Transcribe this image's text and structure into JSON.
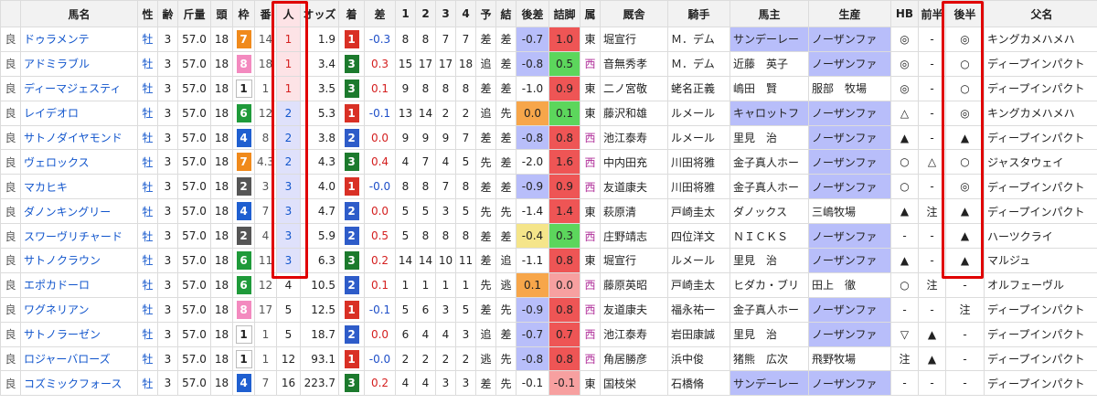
{
  "headers": [
    "",
    "馬名",
    "性",
    "齢",
    "斤量",
    "頭",
    "枠",
    "番",
    "人",
    "オッズ",
    "着",
    "差",
    "1",
    "2",
    "3",
    "4",
    "予",
    "結",
    "後差",
    "詰脚",
    "属",
    "厩舎",
    "騎手",
    "馬主",
    "生産",
    "HB",
    "前半",
    "後半",
    "父名"
  ],
  "colors": {
    "waku": {
      "1": "#ffffff",
      "2": "#555555",
      "3": "#e02222",
      "4": "#1f5fd0",
      "5": "#f2c200",
      "6": "#1f9a3a",
      "7": "#f08a1c",
      "8": "#f38abf"
    },
    "pos1": "#d93025",
    "pos2": "#2e5cc9",
    "pos3": "#1c7a2d",
    "pos_other": "#5a5a5a",
    "highlight_frame": "#e00000",
    "cell_green": "#5cd65c",
    "cell_orange": "#f7a64a",
    "cell_yellow": "#f5e58a",
    "cell_red": "#ee5555",
    "cell_lightred": "#f7a0a0",
    "lavender": "#b8befa"
  },
  "rows": [
    {
      "baba": "良",
      "name": "ドゥラメンテ",
      "sex": "牡",
      "age": "3",
      "kinryo": "57.0",
      "to": "18",
      "waku": "7",
      "ban": "14",
      "nin": "1",
      "odds": "1.9",
      "chaku": "1",
      "sa": "-0.3",
      "p1": "8",
      "p2": "8",
      "p3": "7",
      "p4": "7",
      "yo": "差",
      "ketsu": "差",
      "gosa": "-0.7",
      "gosa_bg": "lav",
      "tsume": "1.0",
      "tsume_bg": "red",
      "zoku": "東",
      "kyusha": "堀宣行",
      "kishu": "Ｍ．デム",
      "banushi": "サンデーレー",
      "banushi_lav": true,
      "seisan": "ノーザンファ",
      "seisan_lav": true,
      "hb": "◎",
      "zen": "-",
      "kou": "◎",
      "chichi": "キングカメハメハ"
    },
    {
      "baba": "良",
      "name": "アドミラブル",
      "sex": "牡",
      "age": "3",
      "kinryo": "57.0",
      "to": "18",
      "waku": "8",
      "ban": "18",
      "nin": "1",
      "odds": "3.4",
      "chaku": "3",
      "sa": "0.3",
      "p1": "15",
      "p2": "17",
      "p3": "17",
      "p4": "18",
      "yo": "追",
      "ketsu": "差",
      "gosa": "-0.8",
      "gosa_bg": "lav",
      "tsume": "0.5",
      "tsume_bg": "green",
      "zoku": "西",
      "kyusha": "音無秀孝",
      "kishu": "Ｍ．デム",
      "banushi": "近藤　英子",
      "banushi_lav": false,
      "seisan": "ノーザンファ",
      "seisan_lav": true,
      "hb": "◎",
      "zen": "-",
      "kou": "○",
      "chichi": "ディープインパクト"
    },
    {
      "baba": "良",
      "name": "ディーマジェスティ",
      "sex": "牡",
      "age": "3",
      "kinryo": "57.0",
      "to": "18",
      "waku": "1",
      "ban": "1",
      "nin": "1",
      "odds": "3.5",
      "chaku": "3",
      "sa": "0.1",
      "p1": "9",
      "p2": "8",
      "p3": "8",
      "p4": "8",
      "yo": "差",
      "ketsu": "差",
      "gosa": "-1.0",
      "gosa_bg": "none",
      "tsume": "0.9",
      "tsume_bg": "red",
      "zoku": "東",
      "kyusha": "二ノ宮敬",
      "kishu": "蛯名正義",
      "banushi": "嶋田　賢",
      "banushi_lav": false,
      "seisan": "服部　牧場",
      "seisan_lav": false,
      "hb": "◎",
      "zen": "-",
      "kou": "○",
      "chichi": "ディープインパクト"
    },
    {
      "baba": "良",
      "name": "レイデオロ",
      "sex": "牡",
      "age": "3",
      "kinryo": "57.0",
      "to": "18",
      "waku": "6",
      "ban": "12",
      "nin": "2",
      "odds": "5.3",
      "chaku": "1",
      "sa": "-0.1",
      "p1": "13",
      "p2": "14",
      "p3": "2",
      "p4": "2",
      "yo": "追",
      "ketsu": "先",
      "gosa": "0.0",
      "gosa_bg": "orange",
      "tsume": "0.1",
      "tsume_bg": "green",
      "zoku": "東",
      "kyusha": "藤沢和雄",
      "kishu": "ルメール",
      "banushi": "キャロットフ",
      "banushi_lav": true,
      "seisan": "ノーザンファ",
      "seisan_lav": true,
      "hb": "△",
      "zen": "-",
      "kou": "◎",
      "chichi": "キングカメハメハ"
    },
    {
      "baba": "良",
      "name": "サトノダイヤモンド",
      "sex": "牡",
      "age": "3",
      "kinryo": "57.0",
      "to": "18",
      "waku": "4",
      "ban": "8",
      "nin": "2",
      "odds": "3.8",
      "chaku": "2",
      "sa": "0.0",
      "p1": "9",
      "p2": "9",
      "p3": "9",
      "p4": "7",
      "yo": "差",
      "ketsu": "差",
      "gosa": "-0.8",
      "gosa_bg": "lav",
      "tsume": "0.8",
      "tsume_bg": "red",
      "zoku": "西",
      "kyusha": "池江泰寿",
      "kishu": "ルメール",
      "banushi": "里見　治",
      "banushi_lav": false,
      "seisan": "ノーザンファ",
      "seisan_lav": true,
      "hb": "▲",
      "zen": "-",
      "kou": "▲",
      "chichi": "ディープインパクト"
    },
    {
      "baba": "良",
      "name": "ヴェロックス",
      "sex": "牡",
      "age": "3",
      "kinryo": "57.0",
      "to": "18",
      "waku": "7",
      "ban": "4.3",
      "nin": "2",
      "odds": "4.3",
      "chaku": "3",
      "sa": "0.4",
      "p1": "4",
      "p2": "7",
      "p3": "4",
      "p4": "5",
      "yo": "先",
      "ketsu": "差",
      "gosa": "-2.0",
      "gosa_bg": "none",
      "tsume": "1.6",
      "tsume_bg": "red",
      "zoku": "西",
      "kyusha": "中内田充",
      "kishu": "川田将雅",
      "banushi": "金子真人ホー",
      "banushi_lav": false,
      "seisan": "ノーザンファ",
      "seisan_lav": true,
      "hb": "○",
      "zen": "△",
      "kou": "○",
      "chichi": "ジャスタウェイ"
    },
    {
      "baba": "良",
      "name": "マカヒキ",
      "sex": "牡",
      "age": "3",
      "kinryo": "57.0",
      "to": "18",
      "waku": "2",
      "ban": "3",
      "nin": "3",
      "odds": "4.0",
      "chaku": "1",
      "sa": "-0.0",
      "p1": "8",
      "p2": "8",
      "p3": "7",
      "p4": "8",
      "yo": "差",
      "ketsu": "差",
      "gosa": "-0.9",
      "gosa_bg": "lav",
      "tsume": "0.9",
      "tsume_bg": "red",
      "zoku": "西",
      "kyusha": "友道康夫",
      "kishu": "川田将雅",
      "banushi": "金子真人ホー",
      "banushi_lav": false,
      "seisan": "ノーザンファ",
      "seisan_lav": true,
      "hb": "○",
      "zen": "-",
      "kou": "◎",
      "chichi": "ディープインパクト"
    },
    {
      "baba": "良",
      "name": "ダノンキングリー",
      "sex": "牡",
      "age": "3",
      "kinryo": "57.0",
      "to": "18",
      "waku": "4",
      "ban": "7",
      "nin": "3",
      "odds": "4.7",
      "chaku": "2",
      "sa": "0.0",
      "p1": "5",
      "p2": "5",
      "p3": "3",
      "p4": "5",
      "yo": "先",
      "ketsu": "先",
      "gosa": "-1.4",
      "gosa_bg": "none",
      "tsume": "1.4",
      "tsume_bg": "red",
      "zoku": "東",
      "kyusha": "萩原清",
      "kishu": "戸崎圭太",
      "banushi": "ダノックス",
      "banushi_lav": false,
      "seisan": "三嶋牧場",
      "seisan_lav": false,
      "hb": "▲",
      "zen": "注",
      "kou": "▲",
      "chichi": "ディープインパクト"
    },
    {
      "baba": "良",
      "name": "スワーヴリチャード",
      "sex": "牡",
      "age": "3",
      "kinryo": "57.0",
      "to": "18",
      "waku": "2",
      "ban": "4",
      "nin": "3",
      "odds": "5.9",
      "chaku": "2",
      "sa": "0.5",
      "p1": "5",
      "p2": "8",
      "p3": "8",
      "p4": "8",
      "yo": "差",
      "ketsu": "差",
      "gosa": "-0.4",
      "gosa_bg": "yellow",
      "tsume": "0.3",
      "tsume_bg": "green",
      "zoku": "西",
      "kyusha": "庄野靖志",
      "kishu": "四位洋文",
      "banushi": "ＮＩＣＫＳ",
      "banushi_lav": false,
      "seisan": "ノーザンファ",
      "seisan_lav": true,
      "hb": "-",
      "zen": "-",
      "kou": "▲",
      "chichi": "ハーツクライ"
    },
    {
      "baba": "良",
      "name": "サトノクラウン",
      "sex": "牡",
      "age": "3",
      "kinryo": "57.0",
      "to": "18",
      "waku": "6",
      "ban": "11",
      "nin": "3",
      "odds": "6.3",
      "chaku": "3",
      "sa": "0.2",
      "p1": "14",
      "p2": "14",
      "p3": "10",
      "p4": "11",
      "yo": "差",
      "ketsu": "追",
      "gosa": "-1.1",
      "gosa_bg": "none",
      "tsume": "0.8",
      "tsume_bg": "red",
      "zoku": "東",
      "kyusha": "堀宣行",
      "kishu": "ルメール",
      "banushi": "里見　治",
      "banushi_lav": false,
      "seisan": "ノーザンファ",
      "seisan_lav": true,
      "hb": "▲",
      "zen": "-",
      "kou": "▲",
      "chichi": "マルジュ"
    },
    {
      "baba": "良",
      "name": "エポカドーロ",
      "sex": "牡",
      "age": "3",
      "kinryo": "57.0",
      "to": "18",
      "waku": "6",
      "ban": "12",
      "nin": "4",
      "odds": "10.5",
      "chaku": "2",
      "sa": "0.1",
      "p1": "1",
      "p2": "1",
      "p3": "1",
      "p4": "1",
      "yo": "先",
      "ketsu": "逃",
      "gosa": "0.1",
      "gosa_bg": "orange",
      "tsume": "0.0",
      "tsume_bg": "lightred",
      "zoku": "西",
      "kyusha": "藤原英昭",
      "kishu": "戸崎圭太",
      "banushi": "ヒダカ・ブリ",
      "banushi_lav": false,
      "seisan": "田上　徹",
      "seisan_lav": false,
      "hb": "○",
      "zen": "注",
      "kou": "-",
      "chichi": "オルフェーヴル"
    },
    {
      "baba": "良",
      "name": "ワグネリアン",
      "sex": "牡",
      "age": "3",
      "kinryo": "57.0",
      "to": "18",
      "waku": "8",
      "ban": "17",
      "nin": "5",
      "odds": "12.5",
      "chaku": "1",
      "sa": "-0.1",
      "p1": "5",
      "p2": "6",
      "p3": "3",
      "p4": "5",
      "yo": "差",
      "ketsu": "先",
      "gosa": "-0.9",
      "gosa_bg": "lav",
      "tsume": "0.8",
      "tsume_bg": "red",
      "zoku": "西",
      "kyusha": "友道康夫",
      "kishu": "福永祐一",
      "banushi": "金子真人ホー",
      "banushi_lav": false,
      "seisan": "ノーザンファ",
      "seisan_lav": true,
      "hb": "-",
      "zen": "-",
      "kou": "注",
      "chichi": "ディープインパクト"
    },
    {
      "baba": "良",
      "name": "サトノラーゼン",
      "sex": "牡",
      "age": "3",
      "kinryo": "57.0",
      "to": "18",
      "waku": "1",
      "ban": "1",
      "nin": "5",
      "odds": "18.7",
      "chaku": "2",
      "sa": "0.0",
      "p1": "6",
      "p2": "4",
      "p3": "4",
      "p4": "3",
      "yo": "追",
      "ketsu": "差",
      "gosa": "-0.7",
      "gosa_bg": "lav",
      "tsume": "0.7",
      "tsume_bg": "red",
      "zoku": "西",
      "kyusha": "池江泰寿",
      "kishu": "岩田康誠",
      "banushi": "里見　治",
      "banushi_lav": false,
      "seisan": "ノーザンファ",
      "seisan_lav": true,
      "hb": "▽",
      "zen": "▲",
      "kou": "-",
      "chichi": "ディープインパクト"
    },
    {
      "baba": "良",
      "name": "ロジャーバローズ",
      "sex": "牡",
      "age": "3",
      "kinryo": "57.0",
      "to": "18",
      "waku": "1",
      "ban": "1",
      "nin": "12",
      "odds": "93.1",
      "chaku": "1",
      "sa": "-0.0",
      "p1": "2",
      "p2": "2",
      "p3": "2",
      "p4": "2",
      "yo": "逃",
      "ketsu": "先",
      "gosa": "-0.8",
      "gosa_bg": "lav",
      "tsume": "0.8",
      "tsume_bg": "red",
      "zoku": "西",
      "kyusha": "角居勝彦",
      "kishu": "浜中俊",
      "banushi": "猪熊　広次",
      "banushi_lav": false,
      "seisan": "飛野牧場",
      "seisan_lav": false,
      "hb": "注",
      "zen": "▲",
      "kou": "-",
      "chichi": "ディープインパクト"
    },
    {
      "baba": "良",
      "name": "コズミックフォース",
      "sex": "牡",
      "age": "3",
      "kinryo": "57.0",
      "to": "18",
      "waku": "4",
      "ban": "7",
      "nin": "16",
      "odds": "223.7",
      "chaku": "3",
      "sa": "0.2",
      "p1": "4",
      "p2": "4",
      "p3": "3",
      "p4": "3",
      "yo": "差",
      "ketsu": "先",
      "gosa": "-0.1",
      "gosa_bg": "none",
      "tsume": "-0.1",
      "tsume_bg": "lightred",
      "zoku": "東",
      "kyusha": "国枝栄",
      "kishu": "石橋脩",
      "banushi": "サンデーレー",
      "banushi_lav": true,
      "seisan": "ノーザンファ",
      "seisan_lav": true,
      "hb": "-",
      "zen": "-",
      "kou": "-",
      "chichi": "ディープインパクト"
    }
  ]
}
